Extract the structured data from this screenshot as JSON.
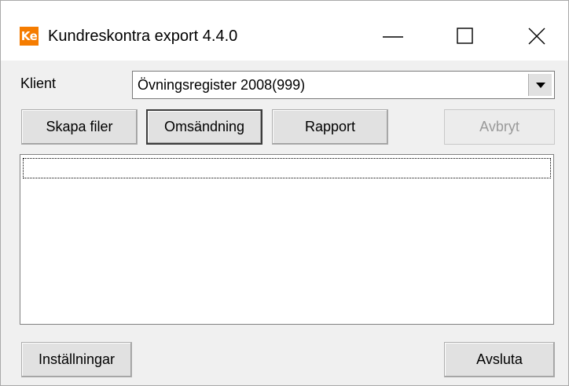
{
  "window": {
    "app_icon_text": "Ke",
    "title": "Kundreskontra export 4.4.0"
  },
  "klient": {
    "label": "Klient",
    "selected": "Övningsregister 2008(999)"
  },
  "toolbar": {
    "skapa_label": "Skapa filer",
    "omsandning_label": "Omsändning",
    "rapport_label": "Rapport",
    "avbryt_label": "Avbryt"
  },
  "log_list": {
    "items": []
  },
  "footer": {
    "installningar_label": "Inställningar",
    "avsluta_label": "Avsluta"
  },
  "colors": {
    "app_icon_bg": "#f57c00",
    "window_bg": "#f0f0f0",
    "titlebar_bg": "#ffffff",
    "button_bg": "#e1e1e1",
    "disabled_text": "#9a9a9a"
  },
  "icons": {
    "minimize": "minimize-icon",
    "maximize": "maximize-icon",
    "close": "close-icon",
    "dropdown": "chevron-down-icon"
  }
}
